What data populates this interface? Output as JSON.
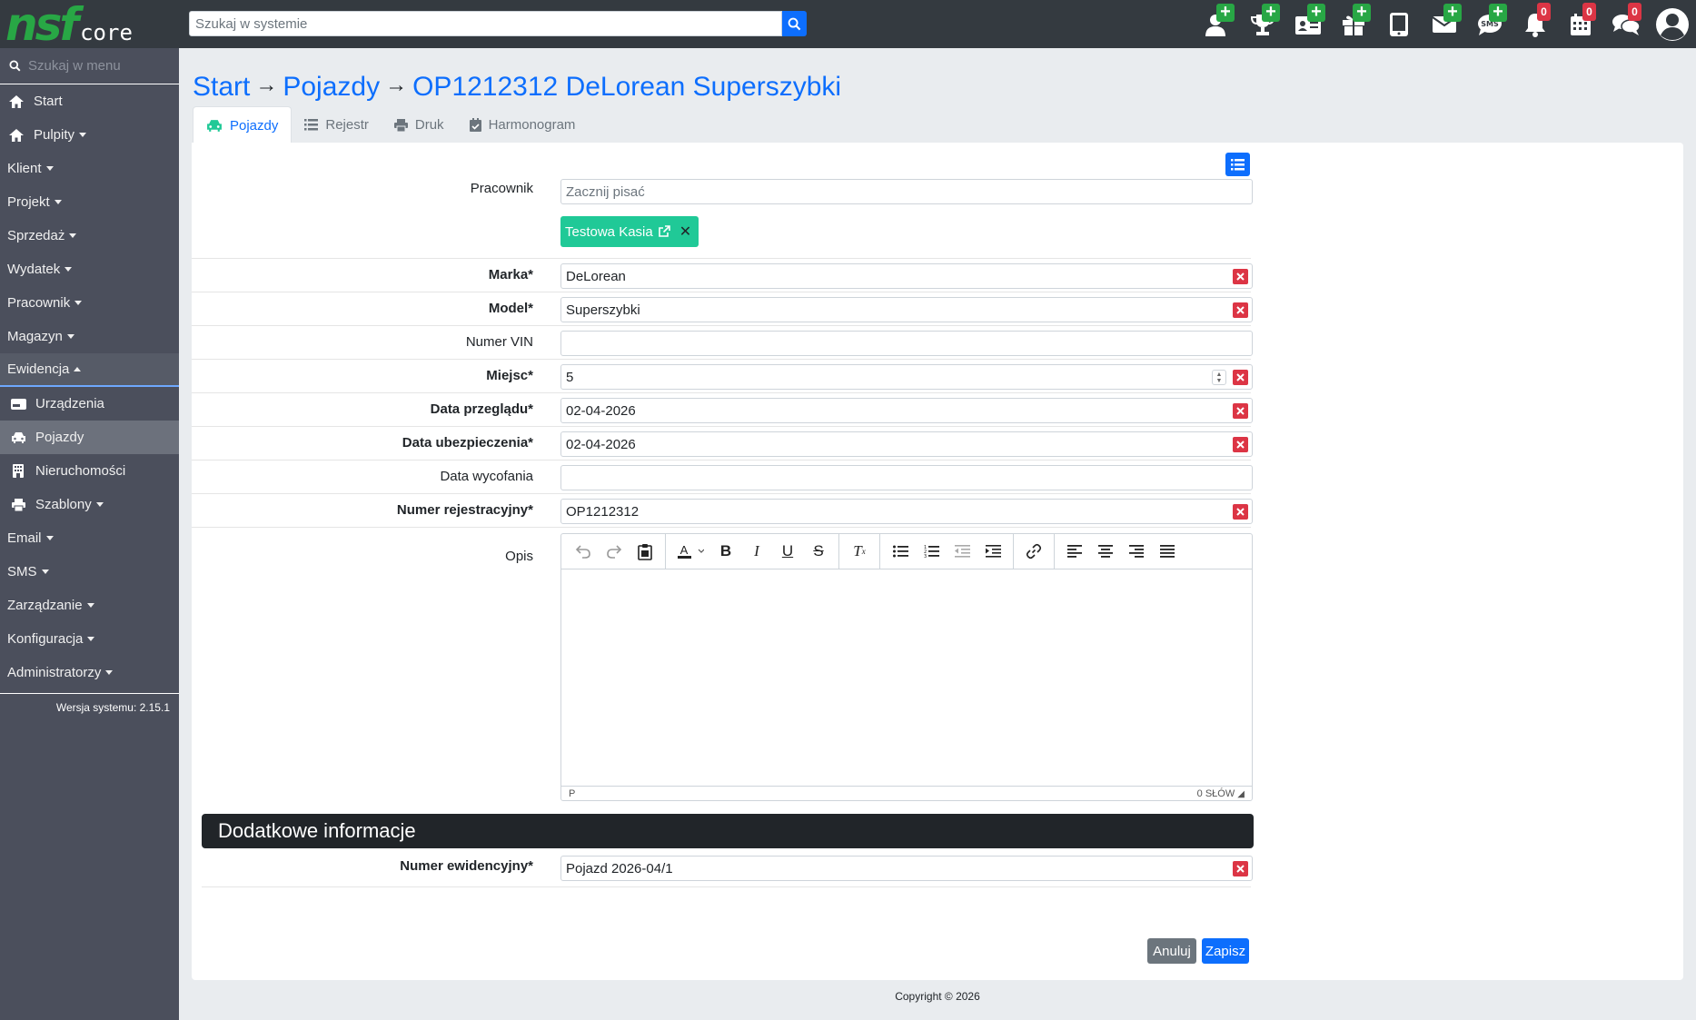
{
  "app": {
    "logo_text": "nsf",
    "logo_sub": "core"
  },
  "search": {
    "placeholder": "Szukaj w systemie"
  },
  "top_icons": [
    {
      "icon": "user-plus-icon",
      "badge": "+"
    },
    {
      "icon": "trophy-plus-icon",
      "badge": "+"
    },
    {
      "icon": "id-card-plus-icon",
      "badge": "+"
    },
    {
      "icon": "gift-plus-icon",
      "badge": "+"
    },
    {
      "icon": "tablet-icon"
    },
    {
      "icon": "envelope-plus-icon",
      "badge": "+"
    },
    {
      "icon": "sms-plus-icon",
      "badge": "+"
    },
    {
      "icon": "bell-icon",
      "count": "0"
    },
    {
      "icon": "calendar-icon",
      "count": "0"
    },
    {
      "icon": "chat-icon",
      "count": "0"
    },
    {
      "icon": "user-avatar-icon"
    }
  ],
  "sidebar": {
    "search_placeholder": "Szukaj w menu",
    "items": {
      "start": "Start",
      "pulpity": "Pulpity",
      "klient": "Klient",
      "projekt": "Projekt",
      "sprzedaz": "Sprzedaż",
      "wydatek": "Wydatek",
      "pracownik": "Pracownik",
      "magazyn": "Magazyn",
      "ewidencja": "Ewidencja",
      "urzadzenia": "Urządzenia",
      "pojazdy": "Pojazdy",
      "nieruchomosci": "Nieruchomości",
      "szablony": "Szablony",
      "email": "Email",
      "sms": "SMS",
      "zarzadzanie": "Zarządzanie",
      "konfiguracja": "Konfiguracja",
      "administratorzy": "Administratorzy"
    },
    "version": "Wersja systemu: 2.15.1"
  },
  "breadcrumb": {
    "start": "Start",
    "pojazdy": "Pojazdy",
    "current": "OP1212312 DeLorean Superszybki"
  },
  "tabs": {
    "pojazdy": "Pojazdy",
    "rejestr": "Rejestr",
    "druk": "Druk",
    "harmonogram": "Harmonogram"
  },
  "form": {
    "pracownik": {
      "label": "Pracownik",
      "placeholder": "Zacznij pisać",
      "tag": "Testowa Kasia"
    },
    "marka": {
      "label": "Marka*",
      "value": "DeLorean"
    },
    "model": {
      "label": "Model*",
      "value": "Superszybki"
    },
    "vin": {
      "label": "Numer VIN",
      "value": ""
    },
    "miejsc": {
      "label": "Miejsc*",
      "value": "5"
    },
    "przeglad": {
      "label": "Data przeglądu*",
      "value": "02-04-2026"
    },
    "ubezpieczenie": {
      "label": "Data ubezpieczenia*",
      "value": "02-04-2026"
    },
    "wycofanie": {
      "label": "Data wycofania",
      "value": ""
    },
    "rejestracja": {
      "label": "Numer rejestracyjny*",
      "value": "OP1212312"
    },
    "opis": {
      "label": "Opis",
      "status_left": "P",
      "status_right": "0 SŁÓW"
    },
    "section_title": "Dodatkowe informacje",
    "ewidencja": {
      "label": "Numer ewidencyjny*",
      "value": "Pojazd 2026-04/1"
    }
  },
  "buttons": {
    "cancel": "Anuluj",
    "save": "Zapisz"
  },
  "footer": "Copyright © 2026",
  "colors": {
    "primary": "#0d6efd",
    "success": "#28a745",
    "danger": "#dc3545",
    "tag": "#20c997",
    "topbar": "#343a40",
    "sidebar": "#4b4f5c"
  }
}
